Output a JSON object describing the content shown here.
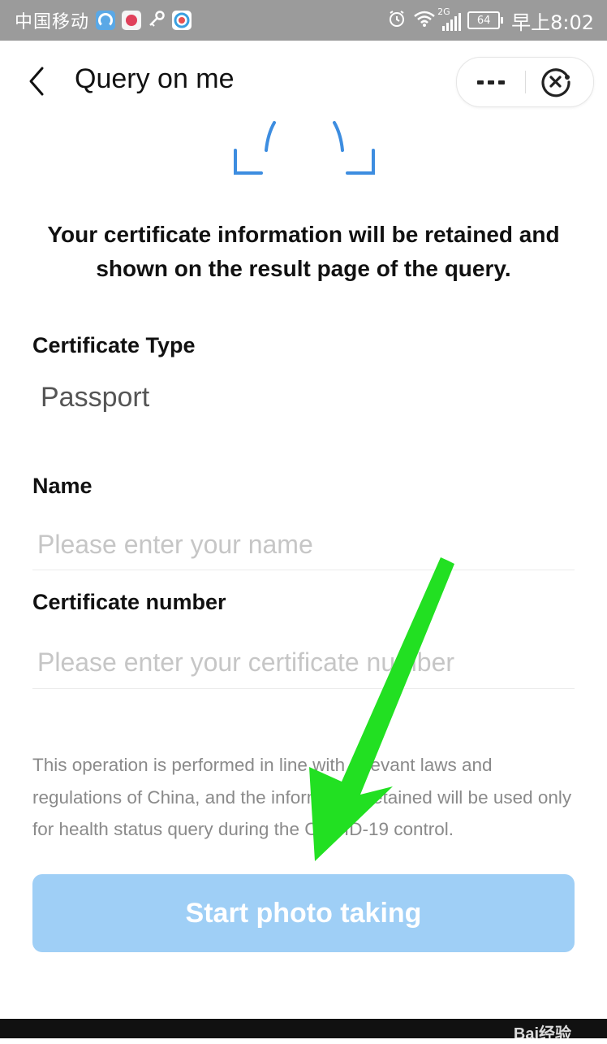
{
  "status_bar": {
    "carrier": "中国移动",
    "network": "2G",
    "battery": "64",
    "time": "早上8:02",
    "icons": [
      "app-icon",
      "app-icon",
      "key-icon",
      "app-icon",
      "alarm-icon",
      "wifi-icon",
      "signal-icon",
      "battery-icon"
    ]
  },
  "header": {
    "title": "Query on me",
    "back_icon": "chevron-left-icon",
    "more_icon": "more-dots-icon",
    "close_icon": "close-circle-icon"
  },
  "notice": "Your certificate information will be retained and shown on the result page of the query.",
  "form": {
    "certificate_type": {
      "label": "Certificate Type",
      "value": "Passport"
    },
    "name": {
      "label": "Name",
      "placeholder": "Please enter your name"
    },
    "certificate_number": {
      "label": "Certificate number",
      "placeholder": "Please enter your certificate number"
    }
  },
  "disclaimer": "This operation is performed in line with relevant laws and regulations of China, and the information retained will be used only for health status query during the COVID-19 control.",
  "primary_button": "Start photo taking",
  "watermark": "Bai经验",
  "colors": {
    "status_bar": "#9b9b9b",
    "accent": "#3d8de0",
    "button": "#9fcff6",
    "annotation_arrow": "#22e022"
  }
}
